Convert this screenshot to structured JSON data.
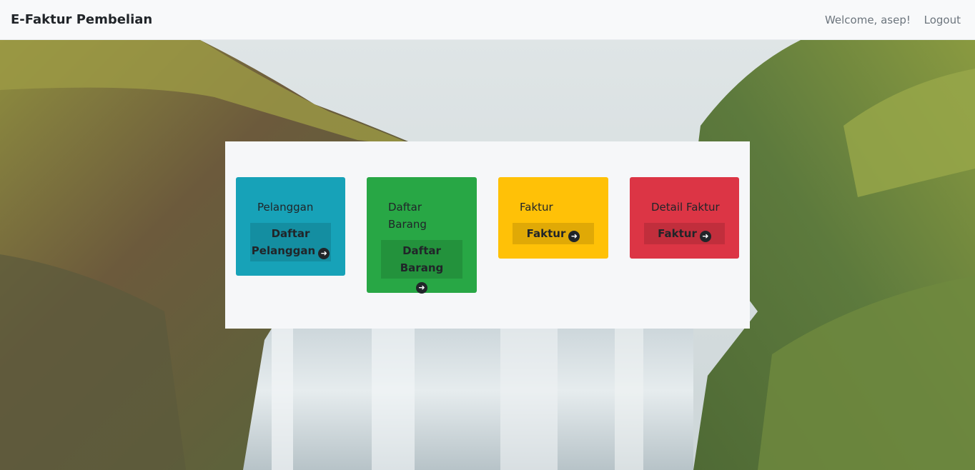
{
  "navbar": {
    "brand": "E-Faktur Pembelian",
    "welcome": "Welcome, asep!",
    "logout": "Logout"
  },
  "cards": [
    {
      "title": "Pelanggan",
      "link": "Daftar Pelanggan",
      "color": "#17a2b8"
    },
    {
      "title": "Daftar Barang",
      "link": "Daftar Barang",
      "color": "#28a745"
    },
    {
      "title": "Faktur",
      "link": "Faktur",
      "color": "#ffc107"
    },
    {
      "title": "Detail Faktur",
      "link": "Faktur",
      "color": "#dc3545"
    }
  ],
  "icons": {
    "link_arrow": "arrow-circle-right-icon"
  }
}
